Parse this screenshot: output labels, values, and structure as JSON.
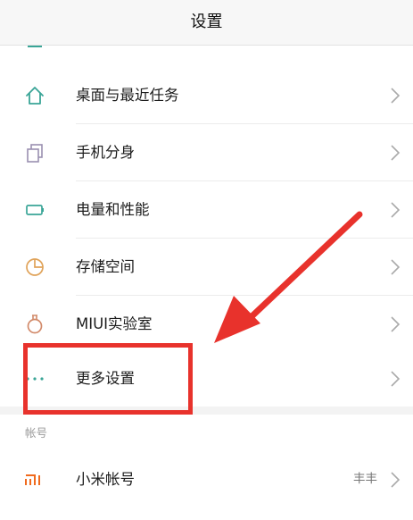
{
  "header": {
    "title": "设置"
  },
  "rows": [
    {
      "label": "桌面与最近任务",
      "icon": "home-icon"
    },
    {
      "label": "手机分身",
      "icon": "clone-icon"
    },
    {
      "label": "电量和性能",
      "icon": "battery-icon"
    },
    {
      "label": "存储空间",
      "icon": "pie-icon"
    },
    {
      "label": "MIUI实验室",
      "icon": "flask-icon"
    },
    {
      "label": "更多设置",
      "icon": "more-dots-icon"
    }
  ],
  "account_section": {
    "label": "帐号",
    "row": {
      "label": "小米帐号",
      "value": "丰丰",
      "icon": "mi-logo-icon"
    }
  },
  "colors": {
    "accent_teal": "#3aa597",
    "icon_gray": "#9a8fb0",
    "annotation_red": "#e8322c",
    "mi_orange": "#f06a1d"
  }
}
